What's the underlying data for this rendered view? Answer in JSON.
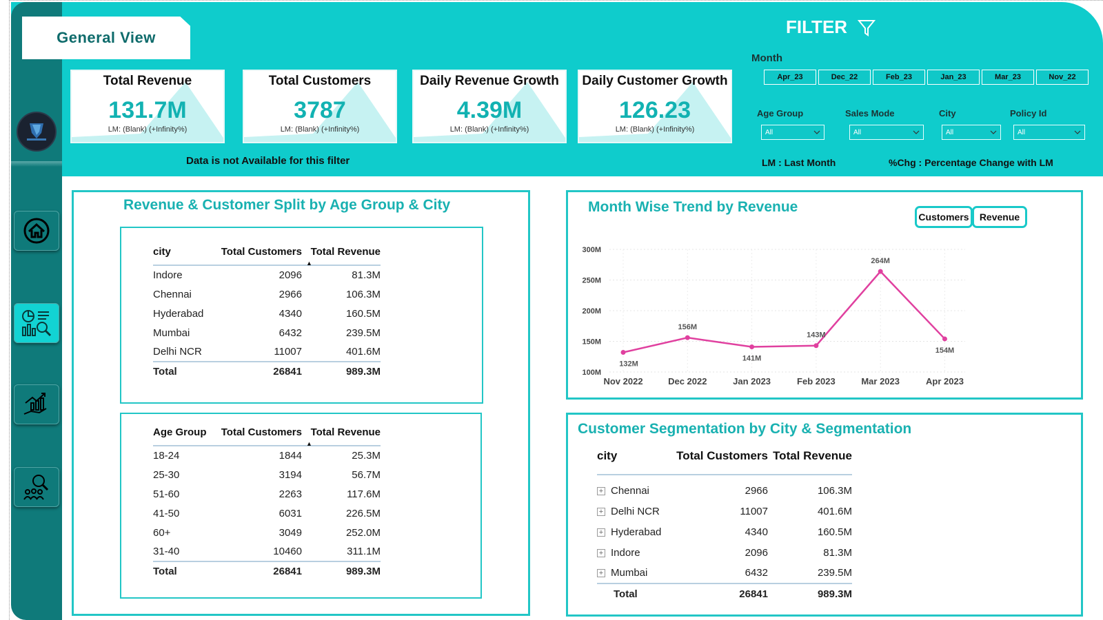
{
  "header": {
    "title": "General View"
  },
  "kpis": [
    {
      "title": "Total Revenue",
      "value": "131.7M",
      "sub": "LM: (Blank) (+Infinity%)"
    },
    {
      "title": "Total Customers",
      "value": "3787",
      "sub": "LM: (Blank) (+Infinity%)"
    },
    {
      "title": "Daily Revenue Growth",
      "value": "4.39M",
      "sub": "LM: (Blank) (+Infinity%)"
    },
    {
      "title": "Daily Customer Growth",
      "value": "126.23",
      "sub": "LM: (Blank) (+Infinity%)"
    }
  ],
  "no_data_message": "Data is not Available for this filter",
  "filter": {
    "heading": "FILTER",
    "month_label": "Month",
    "months": [
      "Apr_23",
      "Dec_22",
      "Feb_23",
      "Jan_23",
      "Mar_23",
      "Nov_22"
    ],
    "age_group_label": "Age Group",
    "sales_mode_label": "Sales Mode",
    "city_label": "City",
    "policy_id_label": "Policy Id",
    "age_group_value": "All",
    "sales_mode_value": "All",
    "city_value": "All",
    "policy_id_value": "All",
    "lm_legend": "LM : Last Month",
    "chg_legend": "%Chg : Percentage Change with LM"
  },
  "split_panel": {
    "title": "Revenue & Customer Split by Age Group & City",
    "city_table": {
      "headers": [
        "city",
        "Total Customers",
        "Total Revenue"
      ],
      "rows": [
        [
          "Indore",
          "2096",
          "81.3M"
        ],
        [
          "Chennai",
          "2966",
          "106.3M"
        ],
        [
          "Hyderabad",
          "4340",
          "160.5M"
        ],
        [
          "Mumbai",
          "6432",
          "239.5M"
        ],
        [
          "Delhi NCR",
          "11007",
          "401.6M"
        ]
      ],
      "total": [
        "Total",
        "26841",
        "989.3M"
      ]
    },
    "age_table": {
      "headers": [
        "Age Group",
        "Total Customers",
        "Total Revenue"
      ],
      "rows": [
        [
          "18-24",
          "1844",
          "25.3M"
        ],
        [
          "25-30",
          "3194",
          "56.7M"
        ],
        [
          "51-60",
          "2263",
          "117.6M"
        ],
        [
          "41-50",
          "6031",
          "226.5M"
        ],
        [
          "60+",
          "3049",
          "252.0M"
        ],
        [
          "31-40",
          "10460",
          "311.1M"
        ]
      ],
      "total": [
        "Total",
        "26841",
        "989.3M"
      ]
    }
  },
  "trend_panel": {
    "title": "Month Wise Trend by Revenue",
    "toggle_customers": "Customers",
    "toggle_revenue": "Revenue"
  },
  "chart_data": {
    "type": "line",
    "title": "Month Wise Trend by Revenue",
    "categories": [
      "Nov 2022",
      "Dec 2022",
      "Jan 2023",
      "Feb 2023",
      "Mar 2023",
      "Apr 2023"
    ],
    "values": [
      132,
      156,
      141,
      143,
      264,
      154
    ],
    "data_labels": [
      "132M",
      "156M",
      "141M",
      "143M",
      "264M",
      "154M"
    ],
    "y_ticks": [
      "100M",
      "150M",
      "200M",
      "250M",
      "300M"
    ],
    "y_tick_values": [
      100,
      150,
      200,
      250,
      300
    ],
    "ylim": [
      100,
      300
    ],
    "line_color": "#e0409f",
    "grid": true
  },
  "segmentation_panel": {
    "title": "Customer Segmentation by City & Segmentation",
    "headers": [
      "city",
      "Total Customers",
      "Total Revenue"
    ],
    "rows": [
      [
        "Chennai",
        "2966",
        "106.3M"
      ],
      [
        "Delhi NCR",
        "11007",
        "401.6M"
      ],
      [
        "Hyderabad",
        "4340",
        "160.5M"
      ],
      [
        "Indore",
        "2096",
        "81.3M"
      ],
      [
        "Mumbai",
        "6432",
        "239.5M"
      ]
    ],
    "total": [
      "Total",
      "26841",
      "989.3M"
    ],
    "expand_glyph": "+"
  },
  "colors": {
    "teal": "#0fcccc",
    "dark_teal": "#0f7a7a",
    "accent_text": "#19b1b1",
    "line": "#e0409f"
  }
}
